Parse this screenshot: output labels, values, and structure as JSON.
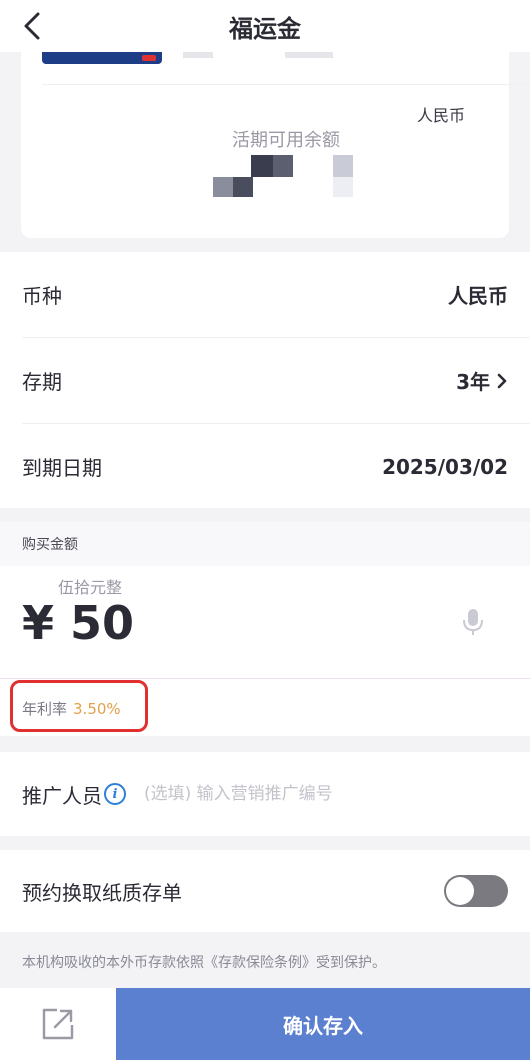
{
  "header": {
    "title": "福运金",
    "back_icon": "chevron-left-icon"
  },
  "card": {
    "currency": "人民币",
    "balance_label": "活期可用余额"
  },
  "info": {
    "currency_label": "币种",
    "currency_value": "人民币",
    "term_label": "存期",
    "term_value": "3年",
    "maturity_label": "到期日期",
    "maturity_value": "2025/03/02"
  },
  "amount": {
    "section_label": "购买金额",
    "words": "伍拾元整",
    "value": "¥ 50",
    "rate_label": "年利率",
    "rate_value": "3.50%"
  },
  "promo": {
    "label": "推广人员",
    "placeholder": "(选填) 输入营销推广编号"
  },
  "paper": {
    "label": "预约换取纸质存单",
    "enabled": false
  },
  "notice": "本机构吸收的本外币存款依照《存款保险条例》受到保护。",
  "footer": {
    "confirm_label": "确认存入"
  },
  "colors": {
    "accent": "#5b80cf",
    "rate": "#e4a04a",
    "highlight": "#e03030",
    "info": "#2e7fd6"
  }
}
